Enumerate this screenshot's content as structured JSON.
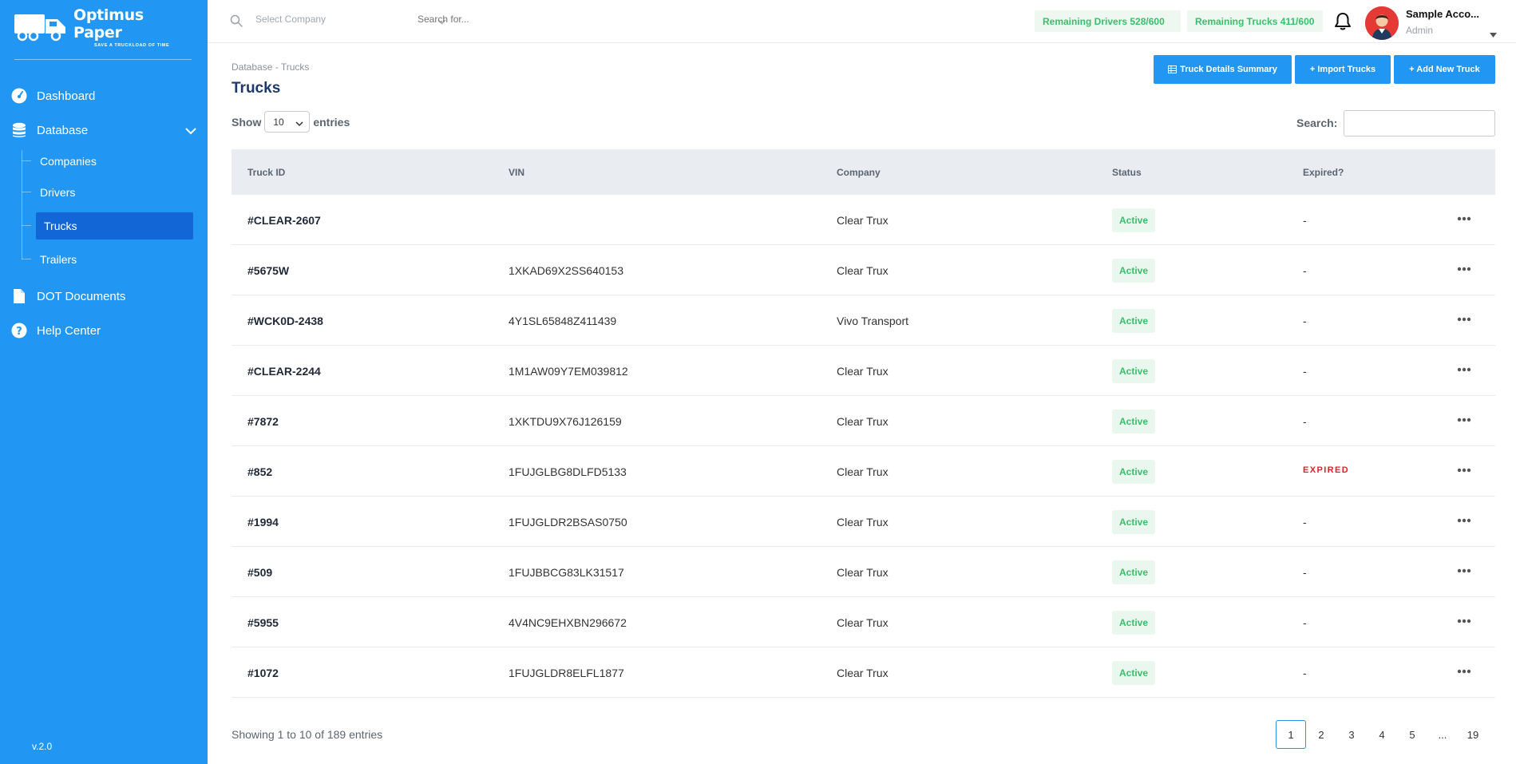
{
  "sidebar": {
    "logo_title": "Optimus Paper",
    "logo_tagline": "SAVE A TRUCKLOAD OF TIME",
    "nav": {
      "dashboard": "Dashboard",
      "database": "Database",
      "dot_documents": "DOT Documents",
      "help_center": "Help Center"
    },
    "subnav": {
      "companies": "Companies",
      "drivers": "Drivers",
      "trucks": "Trucks",
      "trailers": "Trailers"
    },
    "version": "v.2.0"
  },
  "topbar": {
    "company_placeholder": "Select Company",
    "search_placeholder": "Search for...",
    "remaining_drivers": "Remaining Drivers 528/600",
    "remaining_trucks": "Remaining Trucks 411/600",
    "account_name": "Sample Acco...",
    "account_role": "Admin"
  },
  "main": {
    "breadcrumb": "Database - Trucks",
    "title": "Trucks",
    "buttons": {
      "summary": "Truck Details Summary",
      "import": "+ Import Trucks",
      "add": "+ Add New Truck"
    },
    "show_label": "Show",
    "entries_value": "10",
    "entries_label": "entries",
    "search_label": "Search:"
  },
  "table": {
    "headers": [
      "Truck ID",
      "VIN",
      "Company",
      "Status",
      "Expired?"
    ],
    "rows": [
      {
        "id": "#CLEAR-2607",
        "vin": "",
        "company": "Clear Trux",
        "status": "Active",
        "expired": "-"
      },
      {
        "id": "#5675W",
        "vin": "1XKAD69X2SS640153",
        "company": "Clear Trux",
        "status": "Active",
        "expired": "-"
      },
      {
        "id": "#WCK0D-2438",
        "vin": "4Y1SL65848Z411439",
        "company": "Vivo Transport",
        "status": "Active",
        "expired": "-"
      },
      {
        "id": "#CLEAR-2244",
        "vin": "1M1AW09Y7EM039812",
        "company": "Clear Trux",
        "status": "Active",
        "expired": "-"
      },
      {
        "id": "#7872",
        "vin": "1XKTDU9X76J126159",
        "company": "Clear Trux",
        "status": "Active",
        "expired": "-"
      },
      {
        "id": "#852",
        "vin": "1FUJGLBG8DLFD5133",
        "company": "Clear Trux",
        "status": "Active",
        "expired": "EXPIRED"
      },
      {
        "id": "#1994",
        "vin": "1FUJGLDR2BSAS0750",
        "company": "Clear Trux",
        "status": "Active",
        "expired": "-"
      },
      {
        "id": "#509",
        "vin": "1FUJBBCG83LK31517",
        "company": "Clear Trux",
        "status": "Active",
        "expired": "-"
      },
      {
        "id": "#5955",
        "vin": "4V4NC9EHXBN296672",
        "company": "Clear Trux",
        "status": "Active",
        "expired": "-"
      },
      {
        "id": "#1072",
        "vin": "1FUJGLDR8ELFL1877",
        "company": "Clear Trux",
        "status": "Active",
        "expired": "-"
      }
    ],
    "footer_text": "Showing 1 to 10 of 189 entries",
    "pages": [
      "1",
      "2",
      "3",
      "4",
      "5",
      "...",
      "19"
    ],
    "active_page": "1"
  },
  "colors": {
    "sidebar": "#2196f3",
    "active_nav": "#1266d6",
    "primary": "#2196f3",
    "success": "#37bf6a",
    "danger": "#e41e26",
    "title": "#1b3a6b"
  },
  "icons": {
    "dashboard": "gauge-icon",
    "database": "database-icon",
    "dot_documents": "document-icon",
    "help_center": "help-circle-icon",
    "search": "search-icon",
    "notifications": "bell-icon",
    "row_actions": "more-horizontal-icon"
  }
}
